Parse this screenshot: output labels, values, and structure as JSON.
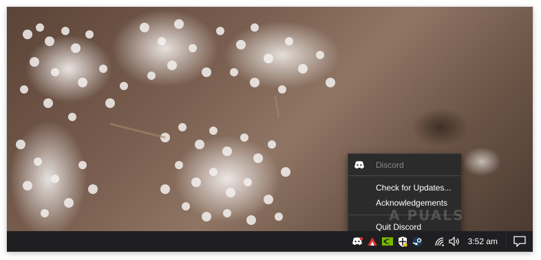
{
  "wallpaper": {
    "description_colors": {
      "flower": "#f0ecea",
      "background": "#6e5648"
    }
  },
  "context_menu": {
    "header_icon": "discord-logo-icon",
    "header_label": "Discord",
    "items": [
      {
        "label": "Check for Updates..."
      },
      {
        "label": "Acknowledgements"
      },
      {
        "label": "Quit Discord"
      }
    ]
  },
  "watermark": "A  PUALS",
  "taskbar": {
    "tray_icons": [
      "discord-tray-icon",
      "red-arrow-tray-icon",
      "nvidia-tray-icon",
      "security-shield-tray-icon",
      "steam-tray-icon",
      "network-icon",
      "volume-icon"
    ],
    "clock": "3:52 am",
    "notification_icon": "action-center-icon",
    "colors": {
      "bar": "#1f1f21",
      "nvidia": "#76b900",
      "discord": "#ffffff",
      "red": "#e03030"
    }
  }
}
